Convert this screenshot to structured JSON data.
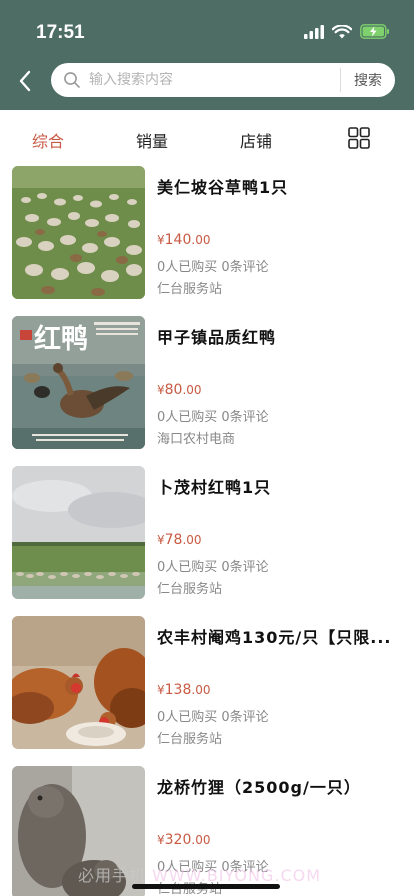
{
  "status_bar": {
    "time": "17:51"
  },
  "search": {
    "placeholder": "输入搜索内容",
    "button_label": "搜索"
  },
  "tabs": [
    {
      "label": "综合",
      "active": true
    },
    {
      "label": "销量",
      "active": false
    },
    {
      "label": "店铺",
      "active": false
    }
  ],
  "view_toggle_icon": "grid-icon",
  "accent_color": "#c85a43",
  "header_color": "#4e6e65",
  "products": [
    {
      "title": "美仁坡谷草鸭1只",
      "currency": "¥",
      "price_int": "140",
      "price_dec": ".00",
      "stats": "0人已购买 0条评论",
      "shop": "仁台服务站",
      "image": "duck-flock-image"
    },
    {
      "title": "甲子镇品质红鸭",
      "currency": "¥",
      "price_int": "80",
      "price_dec": ".00",
      "stats": "0人已购买 0条评论",
      "shop": "海口农村电商",
      "image": "red-duck-poster-image",
      "image_text": "红鸭"
    },
    {
      "title": "卜茂村红鸭1只",
      "currency": "¥",
      "price_int": "78",
      "price_dec": ".00",
      "stats": "0人已购买 0条评论",
      "shop": "仁台服务站",
      "image": "grassland-image"
    },
    {
      "title": "农丰村阉鸡130元/只【只限...",
      "currency": "¥",
      "price_int": "138",
      "price_dec": ".00",
      "stats": "0人已购买 0条评论",
      "shop": "仁台服务站",
      "image": "chicken-image"
    },
    {
      "title": "龙桥竹狸（2500g/一只）",
      "currency": "¥",
      "price_int": "320",
      "price_dec": ".00",
      "stats": "0人已购买 0条评论",
      "shop": "仁台服务站",
      "image": "bamboo-rat-image"
    }
  ],
  "watermark": {
    "cn": "必用手机",
    "en": "WWW.BIYONG.COM"
  }
}
